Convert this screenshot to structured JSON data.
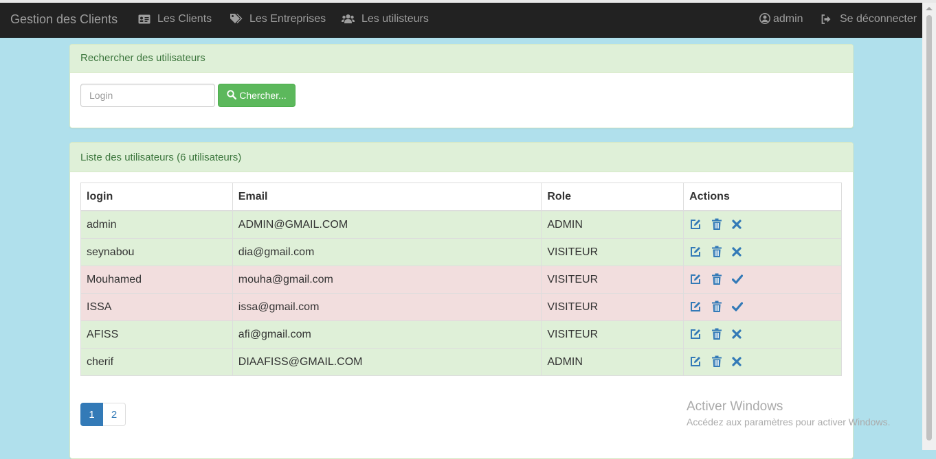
{
  "navbar": {
    "brand": "Gestion des Clients",
    "links": [
      {
        "label": "Les Clients",
        "icon": "id-card-icon"
      },
      {
        "label": "Les Entreprises",
        "icon": "tags-icon"
      },
      {
        "label": "Les utilisteurs",
        "icon": "users-icon"
      }
    ],
    "user": {
      "label": "admin",
      "icon": "user-circle-icon"
    },
    "logout": {
      "label": "Se déconnecter",
      "icon": "sign-out-icon"
    }
  },
  "search_panel": {
    "heading": "Rechercher des utilisateurs",
    "input_placeholder": "Login",
    "input_value": "",
    "button_label": "Chercher...",
    "button_icon": "search-icon"
  },
  "list_panel": {
    "heading": "Liste des utilisateurs (6 utilisateurs)",
    "columns": [
      "login",
      "Email",
      "Role",
      "Actions"
    ],
    "rows": [
      {
        "login": "admin",
        "email": "ADMIN@GMAIL.COM",
        "role": "ADMIN",
        "state": "success",
        "toggle_icon": "times-icon"
      },
      {
        "login": "seynabou",
        "email": "dia@gmail.com",
        "role": "VISITEUR",
        "state": "success",
        "toggle_icon": "times-icon"
      },
      {
        "login": "Mouhamed",
        "email": "mouha@gmail.com",
        "role": "VISITEUR",
        "state": "danger",
        "toggle_icon": "check-icon"
      },
      {
        "login": "ISSA",
        "email": "issa@gmail.com",
        "role": "VISITEUR",
        "state": "danger",
        "toggle_icon": "check-icon"
      },
      {
        "login": "AFISS",
        "email": "afi@gmail.com",
        "role": "VISITEUR",
        "state": "success",
        "toggle_icon": "times-icon"
      },
      {
        "login": "cherif",
        "email": "DIAAFISS@GMAIL.COM",
        "role": "ADMIN",
        "state": "success",
        "toggle_icon": "times-icon"
      }
    ],
    "pagination": [
      "1",
      "2"
    ],
    "current_page": "1"
  },
  "watermark": {
    "title": "Activer Windows",
    "subtitle": "Accédez aux paramètres pour activer Windows."
  },
  "colors": {
    "navbar_bg": "#222222",
    "page_bg": "#b0e0ec",
    "success_row": "#dff0d8",
    "danger_row": "#f2dede",
    "action_icon": "#337ab7",
    "search_button": "#5cb85c"
  }
}
